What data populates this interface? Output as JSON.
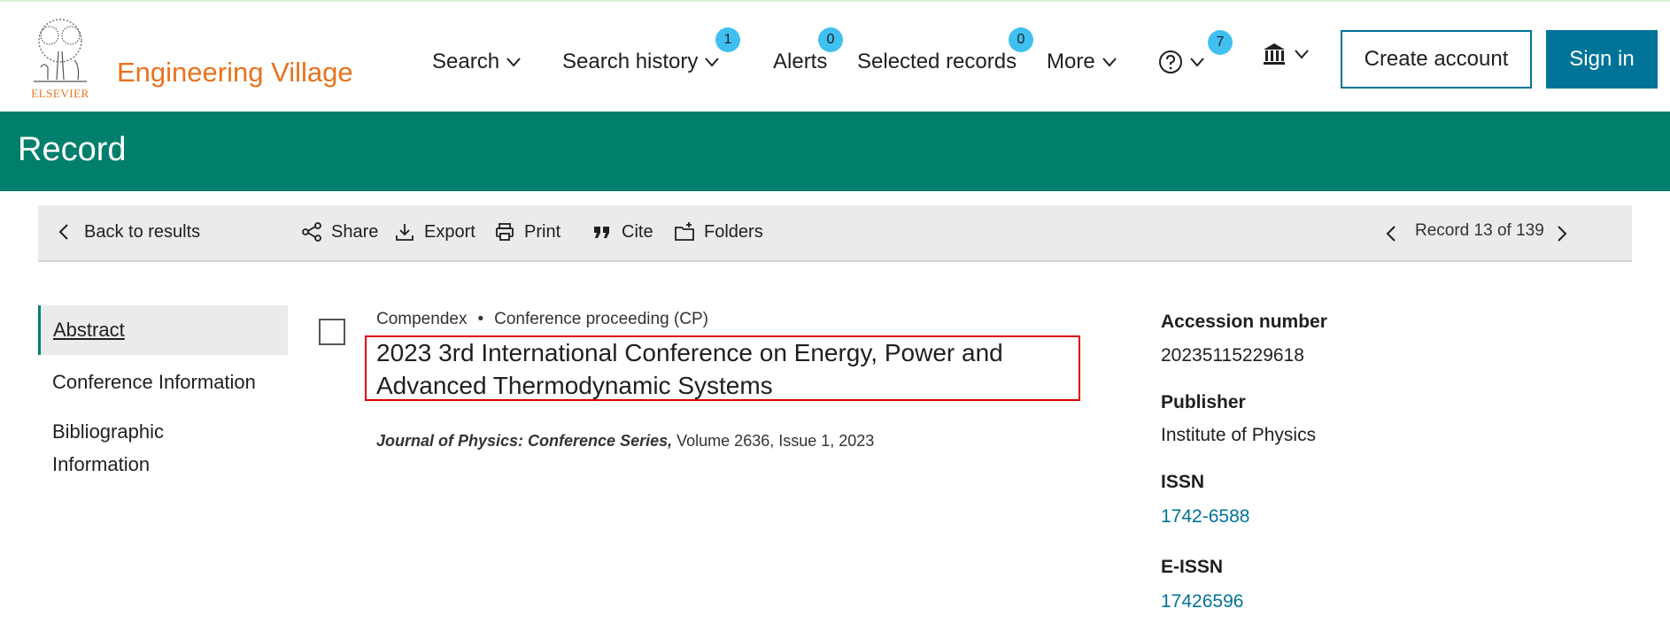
{
  "brand": {
    "publisher": "ELSEVIER",
    "product": "Engineering Village"
  },
  "nav": {
    "search": "Search",
    "search_history": "Search history",
    "search_history_count": "1",
    "alerts": "Alerts",
    "alerts_count": "0",
    "selected_records": "Selected records",
    "selected_records_count": "0",
    "more": "More",
    "help_count": "7",
    "create_account": "Create account",
    "sign_in": "Sign in"
  },
  "banner": {
    "title": "Record"
  },
  "toolbar": {
    "back": "Back to results",
    "share": "Share",
    "export": "Export",
    "print": "Print",
    "cite": "Cite",
    "folders": "Folders",
    "record_position": "Record 13 of 139"
  },
  "sidebar": {
    "items": [
      {
        "label": "Abstract",
        "active": true
      },
      {
        "label": "Conference Information",
        "active": false
      },
      {
        "label": "Bibliographic Information",
        "active": false
      }
    ]
  },
  "record": {
    "database": "Compendex",
    "doc_type": "Conference proceeding (CP)",
    "title": "2023 3rd International Conference on Energy, Power and Advanced Thermodynamic Systems",
    "journal": "Journal of Physics: Conference Series,",
    "volume_issue": "Volume 2636, Issue 1, 2023"
  },
  "details": {
    "accession_label": "Accession number",
    "accession_value": "20235115229618",
    "publisher_label": "Publisher",
    "publisher_value": "Institute of Physics",
    "issn_label": "ISSN",
    "issn_value": "1742-6588",
    "eissn_label": "E-ISSN",
    "eissn_value": "17426596"
  },
  "colors": {
    "brand_orange": "#e9711c",
    "banner_green": "#007f6d",
    "link_blue": "#007398",
    "badge_blue": "#3fc0f0",
    "highlight_red": "#e00000"
  }
}
